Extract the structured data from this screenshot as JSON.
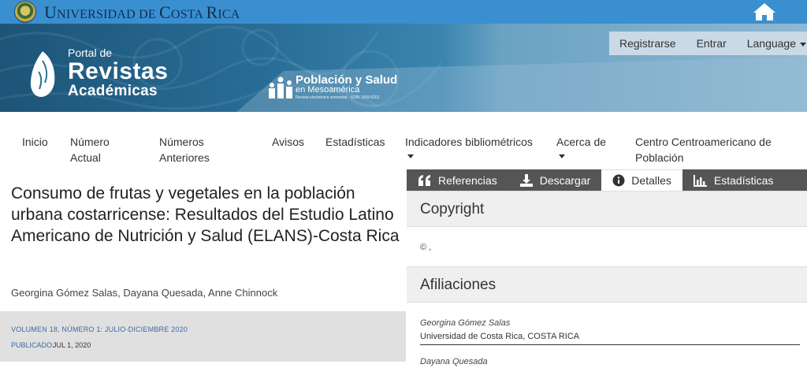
{
  "university": {
    "name_part1": "U",
    "name_part2": "NIVERSIDAD ",
    "name_part3": "DE ",
    "name_part4": "C",
    "name_part5": "OSTA ",
    "name_part6": "R",
    "name_part7": "ICA",
    "logo_icon": "ucr-seal-icon",
    "home_icon": "home-icon"
  },
  "portal": {
    "line1": "Portal de",
    "line2": "Revistas",
    "line3": "Académicas"
  },
  "journal": {
    "title": "Población y Salud",
    "subtitle": "en Mesoamérica",
    "issn": "Revista electrónica semestral · ISSN 1659-0201"
  },
  "user_nav": {
    "register": "Registrarse",
    "login": "Entrar",
    "language": "Language"
  },
  "main_nav": [
    {
      "label": "Inicio"
    },
    {
      "label": "Número Actual"
    },
    {
      "label": "Números Anteriores"
    },
    {
      "label": "Avisos"
    },
    {
      "label": "Estadísticas"
    },
    {
      "label": "Indicadores bibliométricos"
    },
    {
      "label": "Acerca de"
    },
    {
      "label": "Centro Centroamericano de Población"
    }
  ],
  "article": {
    "title": "Consumo de frutas y vegetales en la población urbana costarricense: Resultados del Estudio Latino Americano de Nutrición y Salud (ELANS)-Costa Rica",
    "authors": "Georgina Gómez Salas, Dayana Quesada, Anne Chinnock",
    "volume": "VOLUMEN 18, NÚMERO 1: JULIO-DICIEMBRE 2020",
    "published_label": "PUBLICADO:",
    "published_value": "JUL 1, 2020"
  },
  "tabs": [
    {
      "label": "Referencias",
      "icon": "quote-icon"
    },
    {
      "label": "Descargar",
      "icon": "download-icon"
    },
    {
      "label": "Detalles",
      "icon": "info-icon",
      "active": true
    },
    {
      "label": "Estadísticas",
      "icon": "bar-chart-icon"
    }
  ],
  "details": {
    "copyright_heading": "Copyright",
    "copyright_text": "© ,",
    "affiliations_heading": "Afiliaciones",
    "affiliations": [
      {
        "name": "Georgina Gómez Salas",
        "institution": "Universidad de Costa Rica, COSTA RICA"
      },
      {
        "name": "Dayana Quesada",
        "institution": ""
      }
    ]
  },
  "colors": {
    "top_bar": "#3a8fd0",
    "banner": "#2a6f98",
    "tab_bar": "#555555",
    "meta_box": "#e0e0e0"
  }
}
